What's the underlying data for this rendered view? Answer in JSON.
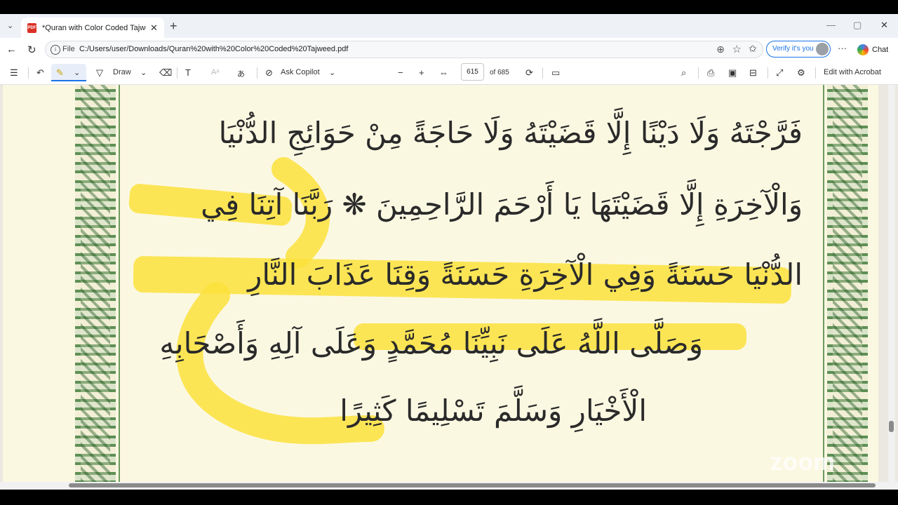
{
  "browser": {
    "tab_title": "*Quran with Color Coded Tajweed",
    "tab_close": "✕",
    "new_tab": "+",
    "tab_menu": "⌄",
    "file_label": "File",
    "url": "C:/Users/user/Downloads/Quran%20with%20Color%20Coded%20Tajweed.pdf",
    "verify_label": "Verify it's you",
    "chat_label": "Chat",
    "more_label": "···",
    "minimize": "—",
    "restore": "▢",
    "close": "✕"
  },
  "pdf_toolbar": {
    "draw_label": "Draw",
    "ask_copilot_label": "Ask Copilot",
    "page_current": "615",
    "page_total": "of 685",
    "edit_label": "Edit with Acrobat"
  },
  "document": {
    "lines": [
      "فَرَّجْتَهُ وَلَا دَيْنًا إِلَّا قَضَيْتَهُ وَلَا حَاجَةً مِنْ حَوَائِجِ الدُّنْيَا",
      "وَالْآخِرَةِ إِلَّا قَضَيْتَهَا يَا أَرْحَمَ الرَّاحِمِينَ ❋ رَبَّنَا آتِنَا فِي",
      "الدُّنْيَا حَسَنَةً وَفِي الْآخِرَةِ حَسَنَةً وَقِنَا عَذَابَ النَّارِ",
      "وَصَلَّى اللَّهُ عَلَى نَبِيِّنَا مُحَمَّدٍ وَعَلَى آلِهِ وَأَصْحَابِهِ",
      "الْأَخْيَارِ وَسَلَّمَ تَسْلِيمًا كَثِيرًا"
    ],
    "watermark": "zoom",
    "highlight_color": "#fce23c"
  }
}
